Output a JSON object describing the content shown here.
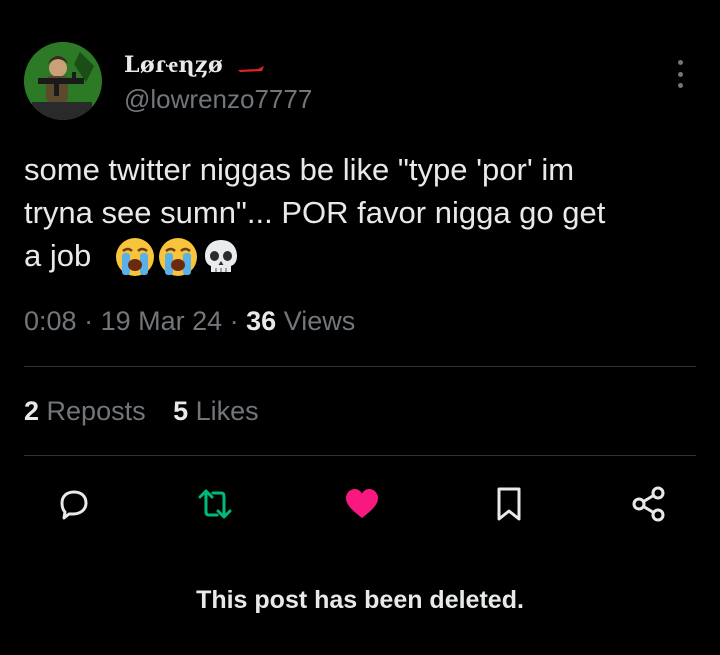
{
  "author": {
    "display_name": "Løɾҽɳȥø",
    "handle": "@lowrenzo7777"
  },
  "post": {
    "text": "some twitter niggas be like \"type 'por' im\ntryna see sumn\"... POR favor nigga go get\na job",
    "emojis": [
      "loudly-crying-face",
      "loudly-crying-face",
      "skull"
    ]
  },
  "meta": {
    "time": "0:08",
    "separator1": " · ",
    "date": "19 Mar 24",
    "separator2": " · ",
    "views_count": "36",
    "views_label": " Views"
  },
  "stats": {
    "reposts_count": "2",
    "reposts_label": " Reposts",
    "likes_count": "5",
    "likes_label": " Likes"
  },
  "actions": {
    "reply_icon": "reply-icon",
    "repost_icon": "repost-icon",
    "like_icon": "like-icon",
    "bookmark_icon": "bookmark-icon",
    "share_icon": "share-icon"
  },
  "colors": {
    "background": "#000000",
    "text": "#e7e9ea",
    "secondary": "#71767b",
    "repost_green": "#00ba7c",
    "like_pink": "#f91880"
  },
  "footer": {
    "deleted_notice": "This post has been deleted."
  }
}
